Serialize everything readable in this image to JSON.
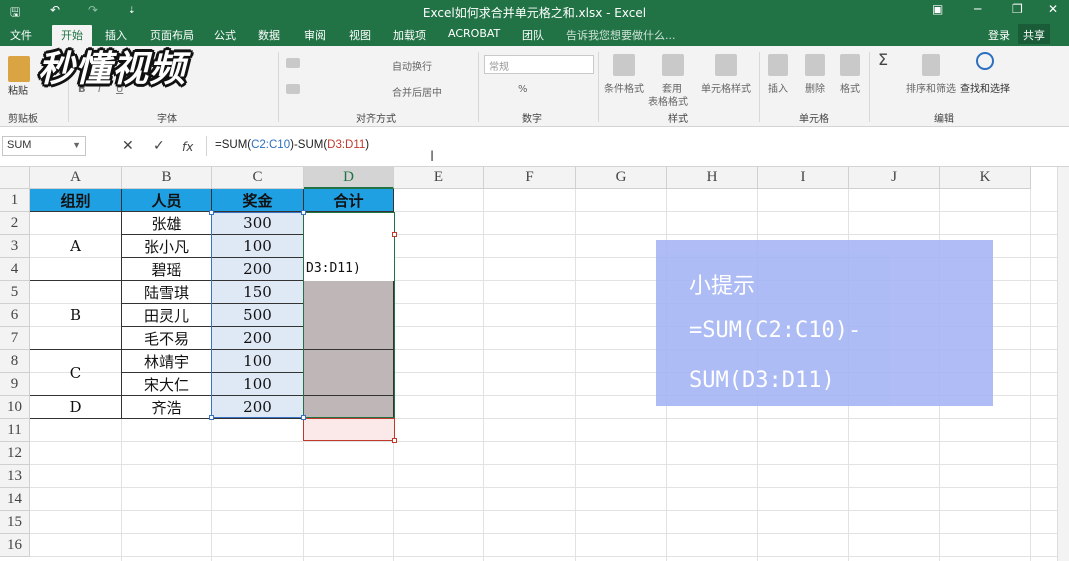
{
  "title_bar": {
    "title": "Excel如何求合并单元格之和.xlsx - Excel",
    "save_icon": "save-icon",
    "undo_icon": "undo-icon",
    "redo_icon": "redo-icon",
    "customize_icon": "customize-icon",
    "ribbon_display_icon": "ribbon-display-icon",
    "minimize_icon": "minimize-icon",
    "restore_icon": "restore-icon",
    "close_icon": "close-icon",
    "glyphs": {
      "save": "🖫",
      "undo": "↶",
      "redo": "↷",
      "custom": "⇣",
      "box": "▣",
      "min": "─",
      "restore": "❐",
      "close": "✕"
    }
  },
  "tabs": [
    "文件",
    "开始",
    "插入",
    "页面布局",
    "公式",
    "数据",
    "审阅",
    "视图",
    "加载项",
    "ACROBAT",
    "团队"
  ],
  "active_tab": "开始",
  "tell_me": "告诉我您想要做什么...",
  "login": "登录",
  "share": "共享",
  "logo_text": "秒懂视频",
  "ribbon": {
    "paste": "粘贴",
    "clipboard": "剪贴板",
    "font_group": "字体",
    "align_group": "对齐方式",
    "number_group": "数字",
    "styles_group": "样式",
    "cells_group": "单元格",
    "edit_group": "编辑",
    "wrap": "自动换行",
    "merge": "合并后居中",
    "number_format": "常规",
    "conditional": "条件格式",
    "table1": "套用",
    "table2": "表格格式",
    "cell_style": "单元格样式",
    "insert": "插入",
    "delete": "删除",
    "format": "格式",
    "sort": "排序和筛选",
    "find": "查找和选择",
    "bold": "B",
    "italic": "I",
    "underline": "U",
    "sigma": "Σ",
    "percent": "%"
  },
  "formula_bar": {
    "name_box": "SUM",
    "cancel": "✕",
    "enter": "✓",
    "fx": "fx",
    "f_pre": "=SUM(",
    "f_ref1": "C2:C10",
    "f_mid": ")-SUM(",
    "f_ref2": "D3:D11",
    "f_post": ")"
  },
  "columns": [
    "A",
    "B",
    "C",
    "D",
    "E",
    "F",
    "G",
    "H",
    "I",
    "J",
    "K"
  ],
  "rows": [
    "1",
    "2",
    "3",
    "4",
    "5",
    "6",
    "7",
    "8",
    "9",
    "10",
    "11",
    "12",
    "13",
    "14",
    "15",
    "16"
  ],
  "headers": [
    "组别",
    "人员",
    "奖金",
    "合计"
  ],
  "groups": [
    "A",
    "B",
    "C",
    "D"
  ],
  "people": [
    "张雄",
    "张小凡",
    "碧瑶",
    "陆雪琪",
    "田灵儿",
    "毛不易",
    "林靖宇",
    "宋大仁",
    "齐浩"
  ],
  "bonus": [
    "300",
    "100",
    "200",
    "150",
    "500",
    "200",
    "100",
    "100",
    "200"
  ],
  "d_edit_text": "D3:D11)",
  "tip": {
    "title": "小提示",
    "line1": "=SUM(C2:C10)-",
    "line2": "SUM(D3:D11)"
  },
  "colors": {
    "green": "#217346",
    "header_blue": "#1fa0e3",
    "tip_bg": "#a6b5f5"
  }
}
